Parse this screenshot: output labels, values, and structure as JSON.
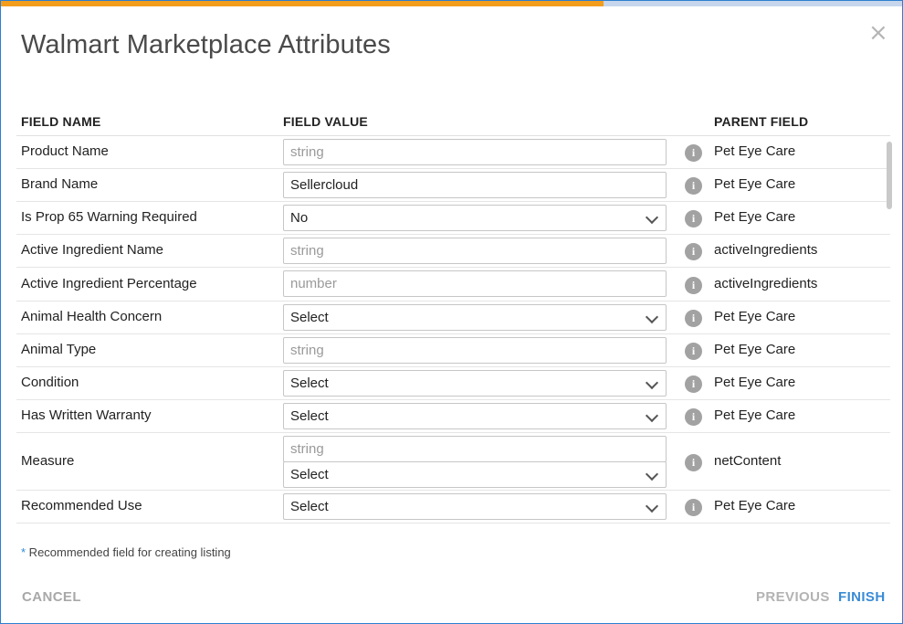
{
  "dialog": {
    "title": "Walmart Marketplace Attributes",
    "close_symbol": "×",
    "progress_percent": 66.7
  },
  "table": {
    "headers": {
      "field_name": "FIELD NAME",
      "field_value": "FIELD VALUE",
      "parent_field": "PARENT FIELD"
    },
    "rows": [
      {
        "name": "Product Name",
        "parent": "Pet Eye Care",
        "value": {
          "type": "text",
          "text": "string",
          "placeholder": true
        }
      },
      {
        "name": "Brand Name",
        "parent": "Pet Eye Care",
        "value": {
          "type": "text",
          "text": "Sellercloud",
          "placeholder": false
        }
      },
      {
        "name": "Is Prop 65 Warning Required",
        "parent": "Pet Eye Care",
        "value": {
          "type": "select",
          "text": "No"
        }
      },
      {
        "name": "Active Ingredient Name",
        "parent": "activeIngredients",
        "value": {
          "type": "text",
          "text": "string",
          "placeholder": true
        }
      },
      {
        "name": "Active Ingredient Percentage",
        "parent": "activeIngredients",
        "value": {
          "type": "text",
          "text": "number",
          "placeholder": true
        }
      },
      {
        "name": "Animal Health Concern",
        "parent": "Pet Eye Care",
        "value": {
          "type": "select",
          "text": "Select"
        }
      },
      {
        "name": "Animal Type",
        "parent": "Pet Eye Care",
        "value": {
          "type": "text",
          "text": "string",
          "placeholder": true
        }
      },
      {
        "name": "Condition",
        "parent": "Pet Eye Care",
        "value": {
          "type": "select",
          "text": "Select"
        }
      },
      {
        "name": "Has Written Warranty",
        "parent": "Pet Eye Care",
        "value": {
          "type": "select",
          "text": "Select"
        }
      },
      {
        "name": "Measure",
        "parent": "netContent",
        "value": {
          "type": "text+select",
          "text": "string",
          "placeholder": true,
          "select_text": "Select"
        }
      },
      {
        "name": "Recommended Use",
        "parent": "Pet Eye Care",
        "value": {
          "type": "select",
          "text": "Select"
        }
      }
    ]
  },
  "info_icon_glyph": "i",
  "note": {
    "star": "*",
    "text": " Recommended field for creating listing"
  },
  "footer": {
    "cancel_label": "CANCEL",
    "previous_label": "PREVIOUS",
    "finish_label": "FINISH"
  },
  "colors": {
    "progress": "#f29d1c",
    "progress_track": "#c7d6ec",
    "accent": "#3a8bd6",
    "border": "#2c7fd1"
  }
}
